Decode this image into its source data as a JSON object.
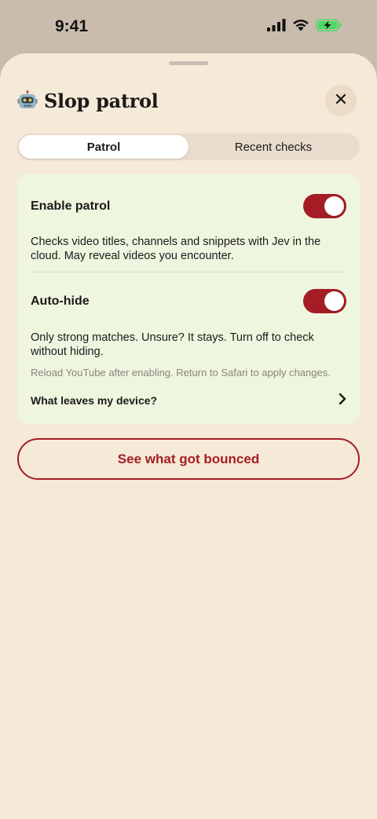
{
  "status_bar": {
    "time": "9:41",
    "icons": [
      "signal-icon",
      "wifi-icon",
      "battery-charging-icon"
    ],
    "battery_color": "#4cd964"
  },
  "header": {
    "app_icon": "robot-icon",
    "title": "Slop patrol",
    "close_icon": "close-icon"
  },
  "tabs": [
    {
      "label": "Patrol",
      "active": true
    },
    {
      "label": "Recent checks",
      "active": false
    }
  ],
  "settings": {
    "enable_patrol": {
      "label": "Enable patrol",
      "on": true,
      "description": "Checks video titles, channels and snippets with Jev in the cloud. May reveal videos you encounter."
    },
    "auto_hide": {
      "label": "Auto-hide",
      "on": true,
      "description": "Only strong matches. Unsure? It stays. Turn off to check without hiding."
    },
    "note": "Reload YouTube after enabling. Return to Safari to apply changes.",
    "privacy_link": "What leaves my device?"
  },
  "action_button": "See what got bounced",
  "colors": {
    "accent": "#a51d24",
    "sheet_background": "#f5e9d8",
    "card_background": "#eef6e0"
  }
}
